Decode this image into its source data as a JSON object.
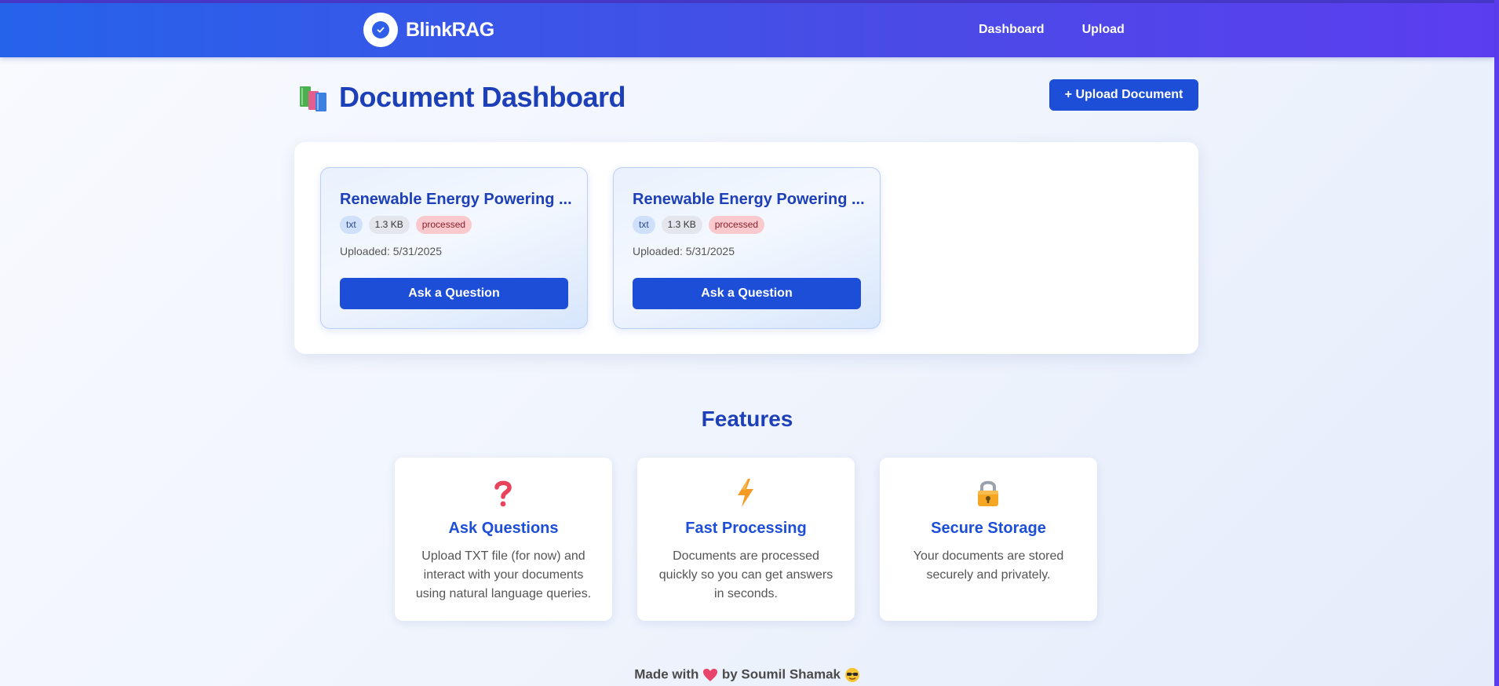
{
  "app": {
    "name": "BlinkRAG"
  },
  "nav": {
    "items": [
      {
        "label": "Dashboard"
      },
      {
        "label": "Upload"
      }
    ]
  },
  "page": {
    "title": "Document Dashboard",
    "title_icon": "books-icon",
    "upload_button": "+ Upload Document"
  },
  "documents": [
    {
      "title": "Renewable Energy Powering ...",
      "type": "txt",
      "size": "1.3 KB",
      "status": "processed",
      "uploaded": "Uploaded: 5/31/2025",
      "action": "Ask a Question"
    },
    {
      "title": "Renewable Energy Powering ...",
      "type": "txt",
      "size": "1.3 KB",
      "status": "processed",
      "uploaded": "Uploaded: 5/31/2025",
      "action": "Ask a Question"
    }
  ],
  "features": {
    "title": "Features",
    "items": [
      {
        "icon": "question-mark-icon",
        "heading": "Ask Questions",
        "description": "Upload TXT file (for now) and interact with your documents using natural language queries."
      },
      {
        "icon": "lightning-icon",
        "heading": "Fast Processing",
        "description": "Documents are processed quickly so you can get answers in seconds."
      },
      {
        "icon": "lock-icon",
        "heading": "Secure Storage",
        "description": "Your documents are stored securely and privately."
      }
    ]
  },
  "footer": {
    "prefix": "Made with",
    "heart_icon": "heart-icon",
    "middle": "by Soumil Shamak",
    "emoji_icon": "sunglasses-face-icon"
  },
  "colors": {
    "primary": "#1d4ed8",
    "title": "#1d3fb8",
    "nav_gradient_start": "#2563eb",
    "nav_gradient_end": "#5b3df0",
    "status_processed_bg": "#fac9cd"
  }
}
